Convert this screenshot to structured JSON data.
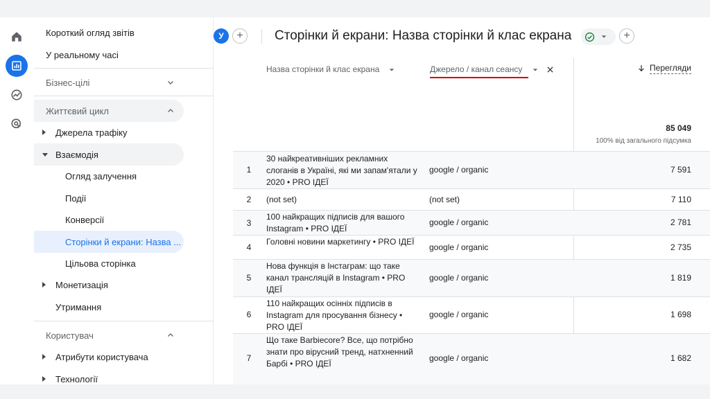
{
  "sidebar": {
    "items": [
      {
        "label": "Короткий огляд звітів"
      },
      {
        "label": "У реальному часі"
      },
      {
        "label": "Бізнес-цілі"
      },
      {
        "label": "Життєвий цикл"
      },
      {
        "label": "Джерела трафіку"
      },
      {
        "label": "Взаємодія"
      },
      {
        "label": "Огляд залучення"
      },
      {
        "label": "Події"
      },
      {
        "label": "Конверсії"
      },
      {
        "label": "Сторінки й екрани: Назва ..."
      },
      {
        "label": "Цільова сторінка"
      },
      {
        "label": "Монетизація"
      },
      {
        "label": "Утримання"
      },
      {
        "label": "Користувач"
      },
      {
        "label": "Атрибути користувача"
      },
      {
        "label": "Технології"
      }
    ]
  },
  "header": {
    "avatar_letter": "У",
    "plus_symbol": "+",
    "title": "Сторінки й екрани: Назва сторінки й клас екрана"
  },
  "table": {
    "dimension_1": "Назва сторінки й клас екрана",
    "dimension_2": "Джерело / канал сеансу",
    "metric": "Перегляди",
    "total": "85 049",
    "total_pct": "100% від загального підсумка",
    "rows": [
      {
        "num": "1",
        "page": "30 найкреативніших рекламних слоганів в Україні, які ми запам'ятали у 2020 • PRO ІДЕЇ",
        "source": "google / organic",
        "views": "7 591"
      },
      {
        "num": "2",
        "page": "(not set)",
        "source": "(not set)",
        "views": "7 110"
      },
      {
        "num": "3",
        "page": "100 найкращих підписів для вашого Instagram • PRO ІДЕЇ",
        "source": "google / organic",
        "views": "2 781"
      },
      {
        "num": "4",
        "page": "Головні новини маркетингу • PRO ІДЕЇ",
        "source": "google / organic",
        "views": "2 735"
      },
      {
        "num": "5",
        "page": "Нова функція в Інстаграм: що таке канал трансляцій в Instagram • PRO ІДЕЇ",
        "source": "google / organic",
        "views": "1 819"
      },
      {
        "num": "6",
        "page": "110 найкращих осінніх підписів в Instagram для просування бізнесу • PRO ІДЕЇ",
        "source": "google / organic",
        "views": "1 698"
      },
      {
        "num": "7",
        "page": "Що таке Barbiecore? Все, що потрібно знати про вірусний тренд, натхненний Барбі • PRO ІДЕЇ",
        "source": "google / organic",
        "views": "1 682"
      }
    ]
  },
  "colors": {
    "accent": "#1a73e8",
    "highlight": "#d50000",
    "success": "#188038"
  }
}
